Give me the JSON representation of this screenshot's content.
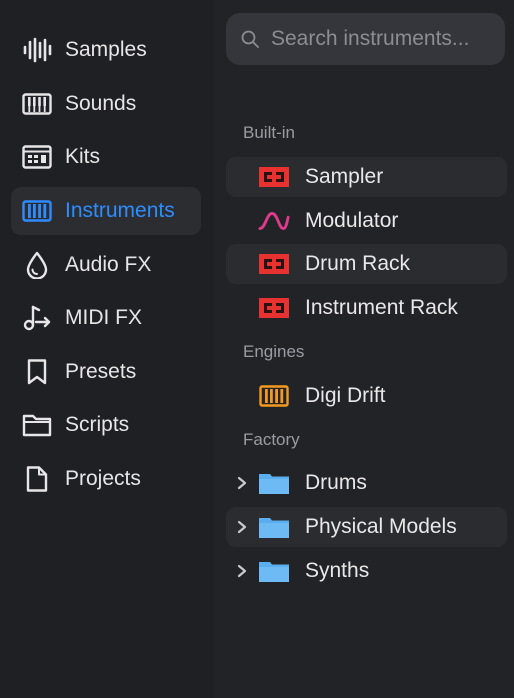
{
  "sidebar": {
    "items": [
      {
        "label": "Samples",
        "icon": "waveform-icon"
      },
      {
        "label": "Sounds",
        "icon": "keyboard-icon"
      },
      {
        "label": "Kits",
        "icon": "drum-pad-icon"
      },
      {
        "label": "Instruments",
        "icon": "piano-keys-icon",
        "active": true
      },
      {
        "label": "Audio FX",
        "icon": "droplet-icon"
      },
      {
        "label": "MIDI FX",
        "icon": "note-arrow-icon"
      },
      {
        "label": "Presets",
        "icon": "bookmark-icon"
      },
      {
        "label": "Scripts",
        "icon": "folder-icon"
      },
      {
        "label": "Projects",
        "icon": "document-icon"
      }
    ]
  },
  "search": {
    "placeholder": "Search instruments..."
  },
  "sections": {
    "builtin": {
      "title": "Built-in",
      "items": [
        "Sampler",
        "Modulator",
        "Drum Rack",
        "Instrument Rack"
      ]
    },
    "engines": {
      "title": "Engines",
      "items": [
        "Digi Drift"
      ]
    },
    "factory": {
      "title": "Factory",
      "items": [
        "Drums",
        "Physical Models",
        "Synths"
      ]
    }
  },
  "colors": {
    "accent": "#2f8cff",
    "rack_red": "#e8322f",
    "modulator_pink": "#e03a8c",
    "engine_orange": "#f39a1e",
    "folder_blue": "#5aaef0"
  }
}
